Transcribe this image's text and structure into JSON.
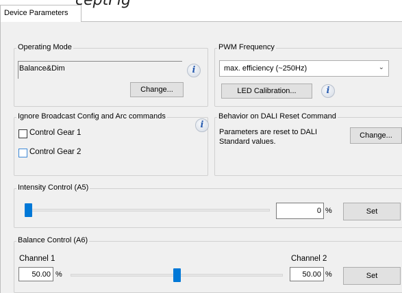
{
  "window": {
    "heading_partial": "ceptFig"
  },
  "tab": {
    "label": "Device Parameters"
  },
  "operating_mode": {
    "legend": "Operating Mode",
    "value": "Balance&Dim",
    "change_label": "Change..."
  },
  "pwm": {
    "legend": "PWM Frequency",
    "selected": "max. efficiency (~250Hz)",
    "led_calibration_label": "LED Calibration..."
  },
  "ignore_broadcast": {
    "legend": "Ignore Broadcast Config and Arc commands",
    "gear1_label": "Control Gear 1",
    "gear2_label": "Control Gear 2"
  },
  "dali_reset": {
    "legend": "Behavior on DALI Reset Command",
    "text_line1": "Parameters are reset to DALI",
    "text_line2": "Standard values.",
    "change_label": "Change..."
  },
  "intensity": {
    "legend": "Intensity Control (A5)",
    "value": "0",
    "unit": "%",
    "set_label": "Set",
    "level_percent": 0
  },
  "balance": {
    "legend": "Balance Control (A6)",
    "channel1_label": "Channel 1",
    "channel2_label": "Channel 2",
    "channel1_value": "50.00",
    "channel2_value": "50.00",
    "unit1": "%",
    "unit2": "%",
    "set_label": "Set",
    "balance_percent": 50
  },
  "icons": {
    "info": "info-icon",
    "dropdown": "chevron-down-icon"
  },
  "colors": {
    "accent": "#0078d7",
    "info_text": "#2a5db0",
    "panel_bg": "#f0f0f0"
  }
}
